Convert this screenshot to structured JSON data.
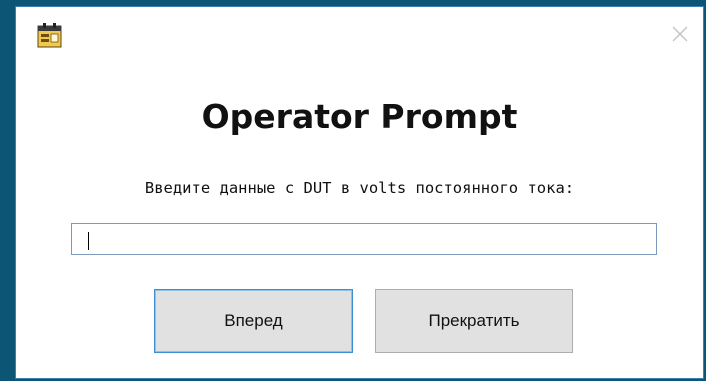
{
  "window": {
    "icon": "form-window-icon",
    "close_icon": "close-icon"
  },
  "dialog": {
    "title": "Operator Prompt",
    "prompt_text": "Введите данные с DUT в volts постоянного тока:",
    "input_value": "",
    "forward_label": "Вперед",
    "cancel_label": "Прекратить"
  },
  "colors": {
    "desktop_background": "#0d5574",
    "dialog_background": "#ffffff",
    "focused_button_border": "#3c8fd4",
    "button_background": "#e1e1e1"
  }
}
